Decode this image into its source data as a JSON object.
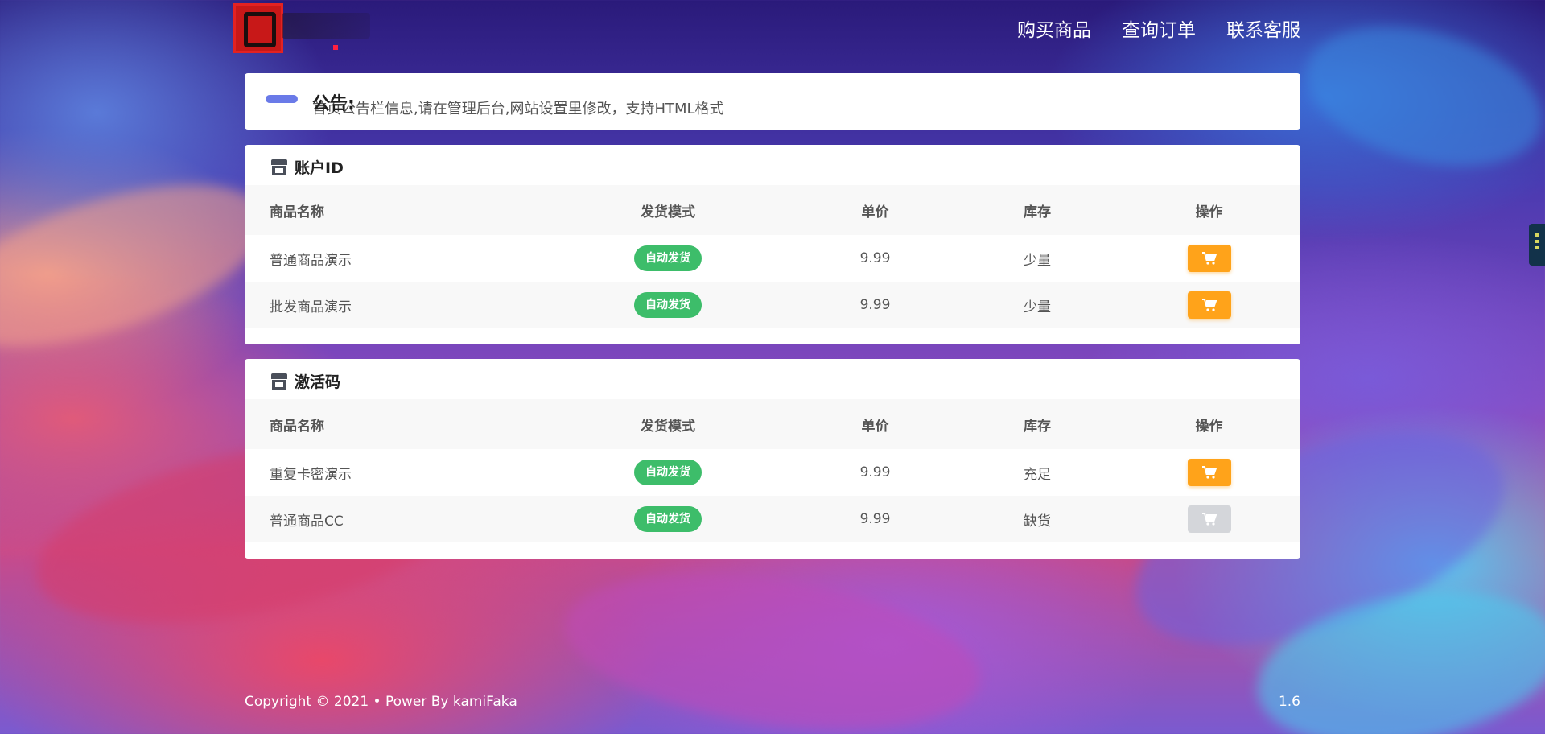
{
  "nav": {
    "items": [
      "购买商品",
      "查询订单",
      "联系客服"
    ]
  },
  "notice": {
    "title": "公告:",
    "text": "首页公告栏信息,请在管理后台,网站设置里修改，支持HTML格式"
  },
  "columns": [
    "商品名称",
    "发货模式",
    "单价",
    "库存",
    "操作"
  ],
  "categories": [
    {
      "name": "账户ID",
      "products": [
        {
          "name": "普通商品演示",
          "mode": "自动发货",
          "price": "9.99",
          "stock": "少量",
          "available": true
        },
        {
          "name": "批发商品演示",
          "mode": "自动发货",
          "price": "9.99",
          "stock": "少量",
          "available": true
        }
      ]
    },
    {
      "name": "激活码",
      "products": [
        {
          "name": "重复卡密演示",
          "mode": "自动发货",
          "price": "9.99",
          "stock": "充足",
          "available": true
        },
        {
          "name": "普通商品CC",
          "mode": "自动发货",
          "price": "9.99",
          "stock": "缺货",
          "available": false
        }
      ]
    }
  ],
  "footer": {
    "copyright": "Copyright © 2021 •  Power By kamiFaka",
    "version": "1.6"
  },
  "colors": {
    "badge_green": "#3dbd6a",
    "buy_orange": "#ffa31a",
    "buy_disabled": "#d4d6da",
    "notice_accent": "#6a7ae8"
  },
  "icons": {
    "category": "store-icon",
    "buy": "shopping-cart-icon"
  }
}
